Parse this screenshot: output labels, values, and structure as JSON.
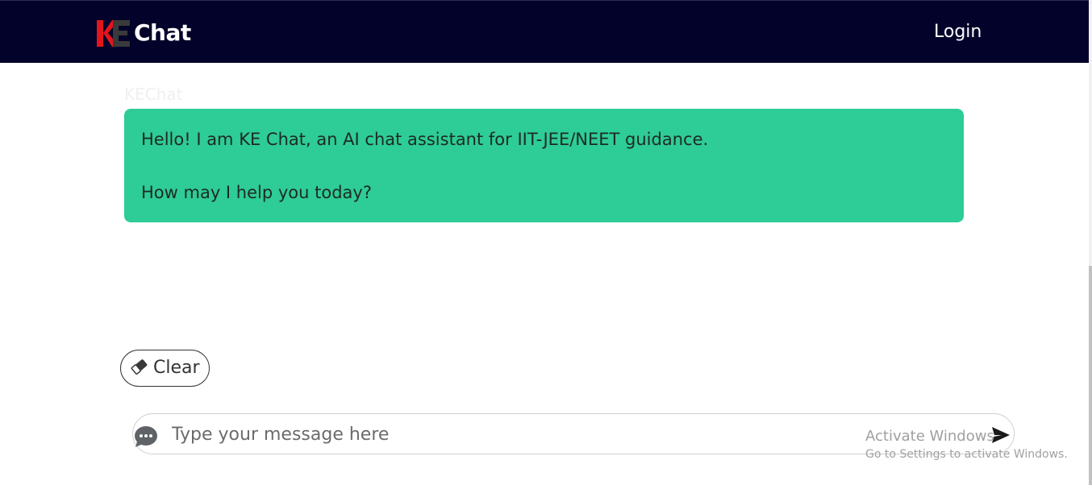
{
  "header": {
    "logo_text": "Chat",
    "logo_mark": "KE",
    "login_label": "Login"
  },
  "chat": {
    "faded_title": "KEChat",
    "messages": [
      {
        "line1": "Hello! I am KE Chat, an AI chat assistant for IIT-JEE/NEET guidance.",
        "line2": "How may I help you today?"
      }
    ]
  },
  "controls": {
    "clear_label": "Clear",
    "input_placeholder": "Type your message here",
    "input_value": ""
  },
  "watermark": {
    "line1": "Activate Windows",
    "line2": "Go to Settings to activate Windows."
  },
  "colors": {
    "navbar_bg": "#03022a",
    "bubble_bg": "#2ecc96",
    "logo_red": "#e3141b",
    "logo_gray": "#3a3a3a"
  },
  "icons": [
    "ke-logo-icon",
    "eraser-icon",
    "chat-bubble-icon",
    "send-icon"
  ]
}
